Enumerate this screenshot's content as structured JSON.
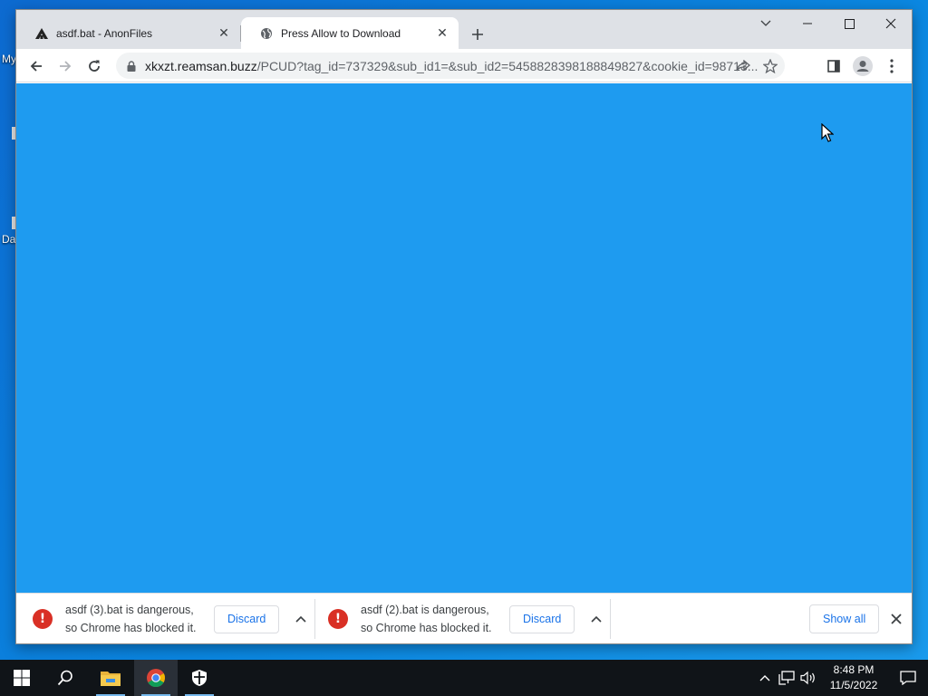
{
  "desktop": {
    "icon_labels": [
      "My",
      "Da"
    ]
  },
  "browser": {
    "tabs": [
      {
        "title": "asdf.bat - AnonFiles",
        "favicon": "anonfiles-icon",
        "active": false
      },
      {
        "title": "Press Allow to Download",
        "favicon": "globe-icon",
        "active": true
      }
    ],
    "address": {
      "host": "xkxzt.reamsan.buzz",
      "path": "/PCUD?tag_id=737329&sub_id1=&sub_id2=5458828398188849827&cookie_id=98713..."
    },
    "page_background": "#1e9bf0"
  },
  "downloads": {
    "items": [
      {
        "line1": "asdf (3).bat is dangerous,",
        "line2": "so Chrome has blocked it.",
        "button": "Discard"
      },
      {
        "line1": "asdf (2).bat is dangerous,",
        "line2": "so Chrome has blocked it.",
        "button": "Discard"
      }
    ],
    "show_all": "Show all"
  },
  "taskbar": {
    "apps": [
      "start-icon",
      "search-icon",
      "file-explorer-icon",
      "chrome-icon",
      "windows-security-icon"
    ],
    "clock": {
      "time": "8:48 PM",
      "date": "11/5/2022"
    }
  },
  "colors": {
    "accent": "#1a73e8",
    "danger": "#d93025",
    "tabstrip": "#dee1e6",
    "taskbar": "#101418"
  }
}
